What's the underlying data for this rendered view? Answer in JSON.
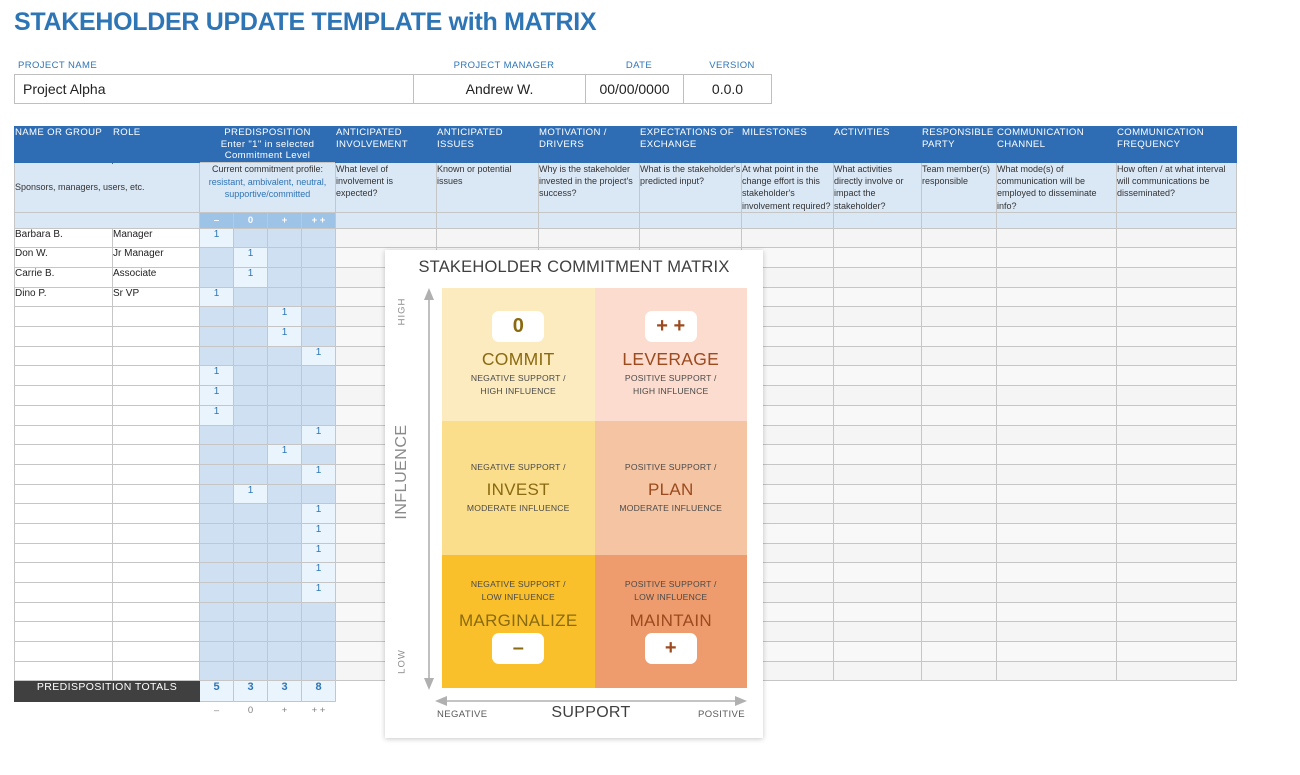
{
  "doc": {
    "title": "STAKEHOLDER UPDATE TEMPLATE with MATRIX"
  },
  "meta": {
    "labels": {
      "project_name": "PROJECT NAME",
      "project_manager": "PROJECT MANAGER",
      "date": "DATE",
      "version": "VERSION"
    },
    "values": {
      "project_name": "Project Alpha",
      "project_manager": "Andrew W.",
      "date": "00/00/0000",
      "version": "0.0.0"
    }
  },
  "table": {
    "headers": {
      "name_or_group": "NAME OR GROUP",
      "role": "ROLE",
      "predisposition": "PREDISPOSITION",
      "predisposition_line2": "Enter \"1\" in selected",
      "predisposition_line3": "Commitment Level",
      "anticipated_involvement": "ANTICIPATED INVOLVEMENT",
      "anticipated_issues": "ANTICIPATED ISSUES",
      "motivation_drivers": "MOTIVATION / DRIVERS",
      "expectations_of_exchange": "EXPECTATIONS OF EXCHANGE",
      "milestones": "MILESTONES",
      "activities": "ACTIVITIES",
      "responsible_party": "RESPONSIBLE PARTY",
      "communication_channel": "COMMUNICATION CHANNEL",
      "communication_frequency": "COMMUNICATION FREQUENCY"
    },
    "subheaders": {
      "name_or_group": "Sponsors, managers, users, etc.",
      "predisposition_title": "Current commitment profile:",
      "predisposition_desc": "resistant, ambivalent, neutral, supportive/committed",
      "anticipated_involvement": "What level of involvement is expected?",
      "anticipated_issues": "Known or potential issues",
      "motivation_drivers": "Why is the stakeholder invested in the project's success?",
      "expectations_of_exchange": "What is the stakeholder's predicted input?",
      "milestones": "At what point in the change effort is this stakeholder's involvement required?",
      "activities": "What activities directly involve or impact the stakeholder?",
      "responsible_party": "Team member(s) responsible",
      "communication_channel": "What mode(s) of communication will be employed to disseminate info?",
      "communication_frequency": "How often / at what interval will communications be disseminated?"
    },
    "commitment_levels": [
      "–",
      "0",
      "+",
      "+ +"
    ],
    "rows": [
      {
        "name": "Barbara B.",
        "role": "Manager",
        "marks": [
          1,
          0,
          0,
          0
        ]
      },
      {
        "name": "Don W.",
        "role": "Jr Manager",
        "marks": [
          0,
          1,
          0,
          0
        ]
      },
      {
        "name": "Carrie B.",
        "role": "Associate",
        "marks": [
          0,
          1,
          0,
          0
        ]
      },
      {
        "name": "Dino P.",
        "role": "Sr VP",
        "marks": [
          1,
          0,
          0,
          0
        ]
      },
      {
        "name": "",
        "role": "",
        "marks": [
          0,
          0,
          1,
          0
        ]
      },
      {
        "name": "",
        "role": "",
        "marks": [
          0,
          0,
          1,
          0
        ]
      },
      {
        "name": "",
        "role": "",
        "marks": [
          0,
          0,
          0,
          1
        ]
      },
      {
        "name": "",
        "role": "",
        "marks": [
          1,
          0,
          0,
          0
        ]
      },
      {
        "name": "",
        "role": "",
        "marks": [
          1,
          0,
          0,
          0
        ]
      },
      {
        "name": "",
        "role": "",
        "marks": [
          1,
          0,
          0,
          0
        ]
      },
      {
        "name": "",
        "role": "",
        "marks": [
          0,
          0,
          0,
          1
        ]
      },
      {
        "name": "",
        "role": "",
        "marks": [
          0,
          0,
          1,
          0
        ]
      },
      {
        "name": "",
        "role": "",
        "marks": [
          0,
          0,
          0,
          1
        ]
      },
      {
        "name": "",
        "role": "",
        "marks": [
          0,
          1,
          0,
          0
        ]
      },
      {
        "name": "",
        "role": "",
        "marks": [
          0,
          0,
          0,
          1
        ]
      },
      {
        "name": "",
        "role": "",
        "marks": [
          0,
          0,
          0,
          1
        ]
      },
      {
        "name": "",
        "role": "",
        "marks": [
          0,
          0,
          0,
          1
        ]
      },
      {
        "name": "",
        "role": "",
        "marks": [
          0,
          0,
          0,
          1
        ]
      },
      {
        "name": "",
        "role": "",
        "marks": [
          0,
          0,
          0,
          1
        ]
      },
      {
        "name": "",
        "role": "",
        "marks": [
          0,
          0,
          0,
          0
        ]
      },
      {
        "name": "",
        "role": "",
        "marks": [
          0,
          0,
          0,
          0
        ]
      },
      {
        "name": "",
        "role": "",
        "marks": [
          0,
          0,
          0,
          0
        ]
      },
      {
        "name": "",
        "role": "",
        "marks": [
          0,
          0,
          0,
          0
        ]
      }
    ],
    "totals": {
      "label": "PREDISPOSITION TOTALS",
      "values": [
        5,
        3,
        3,
        8
      ]
    },
    "footer_signs": [
      "–",
      "0",
      "+",
      "+ +"
    ]
  },
  "matrix": {
    "title": "STAKEHOLDER COMMITMENT MATRIX",
    "y_axis": {
      "label": "INFLUENCE",
      "high": "HIGH",
      "low": "LOW"
    },
    "x_axis": {
      "label": "SUPPORT",
      "negative": "NEGATIVE",
      "positive": "POSITIVE"
    },
    "quadrants": [
      {
        "id": "commit",
        "badge": "0",
        "name": "COMMIT",
        "sub_line1": "NEGATIVE SUPPORT /",
        "sub_line2": "HIGH INFLUENCE",
        "color": "#FCEBBF"
      },
      {
        "id": "leverage",
        "badge": "+ +",
        "name": "LEVERAGE",
        "sub_line1": "POSITIVE SUPPORT /",
        "sub_line2": "HIGH INFLUENCE",
        "color": "#FBDCCE"
      },
      {
        "id": "invest",
        "badge": "",
        "name": "INVEST",
        "sub_line1": "NEGATIVE SUPPORT /",
        "sub_line2": "MODERATE INFLUENCE",
        "color": "#FBDE8C"
      },
      {
        "id": "plan",
        "badge": "",
        "name": "PLAN",
        "sub_line1": "POSITIVE SUPPORT /",
        "sub_line2": "MODERATE INFLUENCE",
        "color": "#F5C4A3"
      },
      {
        "id": "marginalize",
        "badge": "–",
        "name": "MARGINALIZE",
        "sub_line1": "NEGATIVE SUPPORT /",
        "sub_line2": "LOW INFLUENCE",
        "color": "#FAC02C"
      },
      {
        "id": "maintain",
        "badge": "+",
        "name": "MAINTAIN",
        "sub_line1": "POSITIVE SUPPORT /",
        "sub_line2": "LOW INFLUENCE",
        "color": "#EE9C6E"
      }
    ]
  },
  "colors": {
    "title_blue": "#2E75B6",
    "header_blue": "#2E6DB4",
    "subheader_blue": "#DAE7F5",
    "sign_blue": "#9DC3E6",
    "totals_dark": "#404040"
  }
}
